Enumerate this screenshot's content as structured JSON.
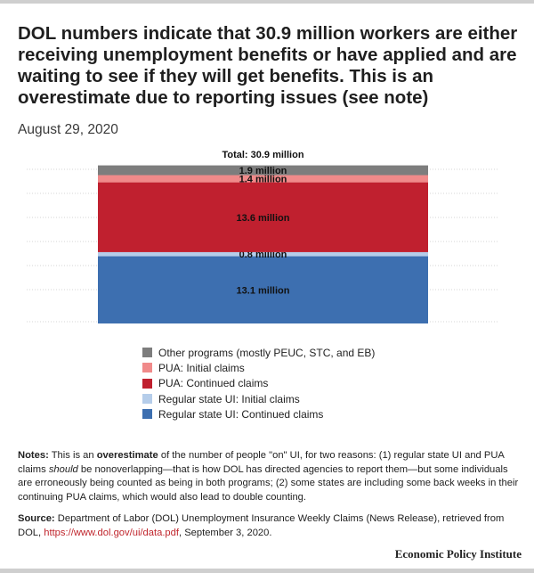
{
  "title": "DOL numbers indicate that 30.9 million workers are either receiving unemployment benefits or have applied and are waiting to see if they will get benefits. This is an overestimate due to reporting issues (see note)",
  "subtitle": "August 29, 2020",
  "chart_data": {
    "type": "bar",
    "stacked": true,
    "categories": [
      ""
    ],
    "total_label": "Total: 30.9 million",
    "total": 30.9,
    "grid": true,
    "legend_position": "bottom",
    "series": [
      {
        "name": "Regular state UI: Continued claims",
        "value": 13.1,
        "label": "13.1 million",
        "color": "#3d6fb0"
      },
      {
        "name": "Regular state UI: Initial claims",
        "value": 0.8,
        "label": "0.8 million",
        "color": "#b5cdea"
      },
      {
        "name": "PUA: Continued claims",
        "value": 13.6,
        "label": "13.6 million",
        "color": "#c0202f"
      },
      {
        "name": "PUA: Initial claims",
        "value": 1.4,
        "label": "1.4 million",
        "color": "#f08a8a"
      },
      {
        "name": "Other programs (mostly PEUC, STC, and EB)",
        "value": 1.9,
        "label": "1.9 million",
        "color": "#7d7d7d"
      }
    ]
  },
  "legend": [
    {
      "label": "Other programs (mostly PEUC, STC, and EB)",
      "color": "#7d7d7d"
    },
    {
      "label": "PUA: Initial claims",
      "color": "#f08a8a"
    },
    {
      "label": "PUA: Continued claims",
      "color": "#c0202f"
    },
    {
      "label": "Regular state UI: Initial claims",
      "color": "#b5cdea"
    },
    {
      "label": "Regular state UI: Continued claims",
      "color": "#3d6fb0"
    }
  ],
  "notes": {
    "label": "Notes:",
    "text1": " This is an ",
    "bold": "overestimate",
    "text2": " of the number of people \"on\" UI, for two reasons: (1) regular state UI and PUA claims ",
    "italic": "should",
    "text3": " be nonoverlapping—that is how DOL has directed agencies to report them—but some individuals are erroneously being counted as being in both programs; (2) some states are including some back weeks in their continuing PUA claims, which would also lead to double counting."
  },
  "source": {
    "label": "Source:",
    "text1": " Department of Labor (DOL) Unemployment Insurance Weekly Claims (News Release), retrieved from DOL, ",
    "link": "https://www.dol.gov/ui/data.pdf",
    "text2": ", September 3, 2020."
  },
  "brand": "Economic Policy Institute"
}
